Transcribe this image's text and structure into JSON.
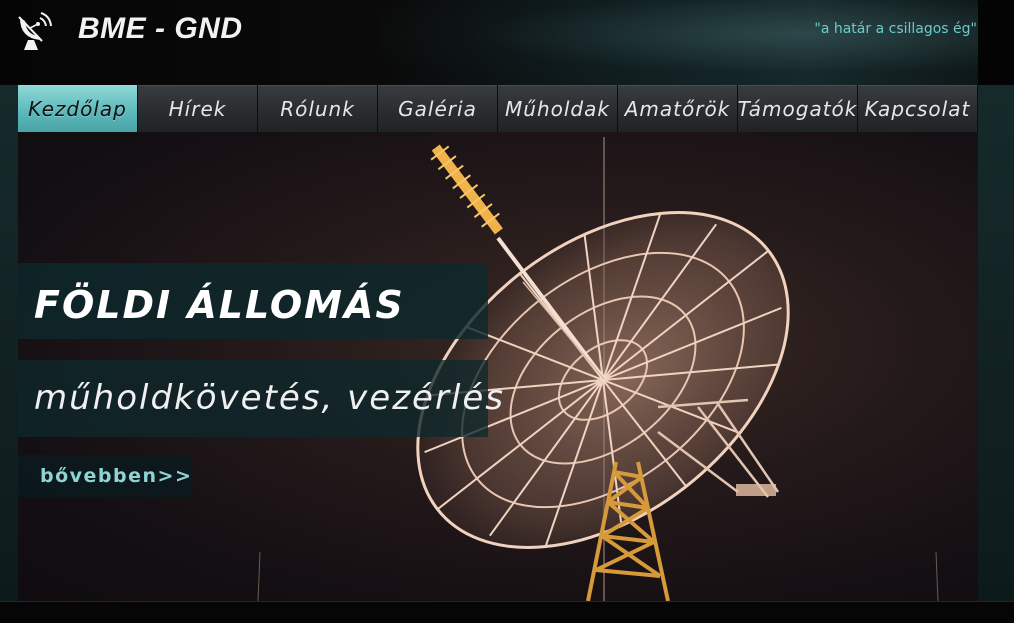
{
  "header": {
    "site_title": "BME - GND",
    "tagline": "\"a határ a csillagos ég\"",
    "logo_icon": "satellite-dish-icon"
  },
  "nav": {
    "items": [
      {
        "label": "Kezdőlap",
        "active": true
      },
      {
        "label": "Hírek",
        "active": false
      },
      {
        "label": "Rólunk",
        "active": false
      },
      {
        "label": "Galéria",
        "active": false
      },
      {
        "label": "Műholdak",
        "active": false
      },
      {
        "label": "Amatőrök",
        "active": false
      },
      {
        "label": "Támogatók",
        "active": false
      },
      {
        "label": "Kapcsolat",
        "active": false
      }
    ]
  },
  "hero": {
    "title": "FÖLDI ÁLLOMÁS",
    "subtitle": "műholdkövetés, vezérlés",
    "more_label": "bővebben>>"
  },
  "colors": {
    "accent": "#5bb7b9",
    "tagline": "#6fc9cc",
    "more_link": "#8fd3d6"
  }
}
